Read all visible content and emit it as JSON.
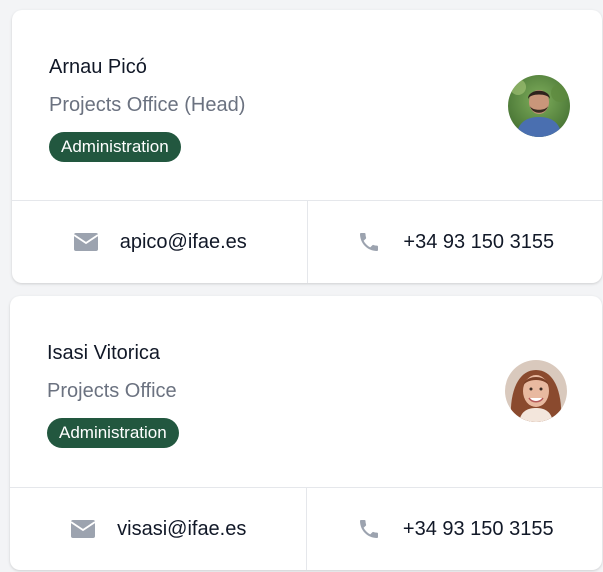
{
  "accent_color": "#22573f",
  "icon_color": "#9ca3af",
  "contacts": [
    {
      "name": "Arnau Picó",
      "role": "Projects Office (Head)",
      "department": "Administration",
      "email": "apico@ifae.es",
      "phone": "+34 93 150 3155",
      "avatar_icon": "avatar-photo",
      "email_icon": "mail-icon",
      "phone_icon": "phone-icon"
    },
    {
      "name": "Isasi Vitorica",
      "role": "Projects Office",
      "department": "Administration",
      "email": "visasi@ifae.es",
      "phone": "+34 93 150 3155",
      "avatar_icon": "avatar-photo",
      "email_icon": "mail-icon",
      "phone_icon": "phone-icon"
    }
  ]
}
